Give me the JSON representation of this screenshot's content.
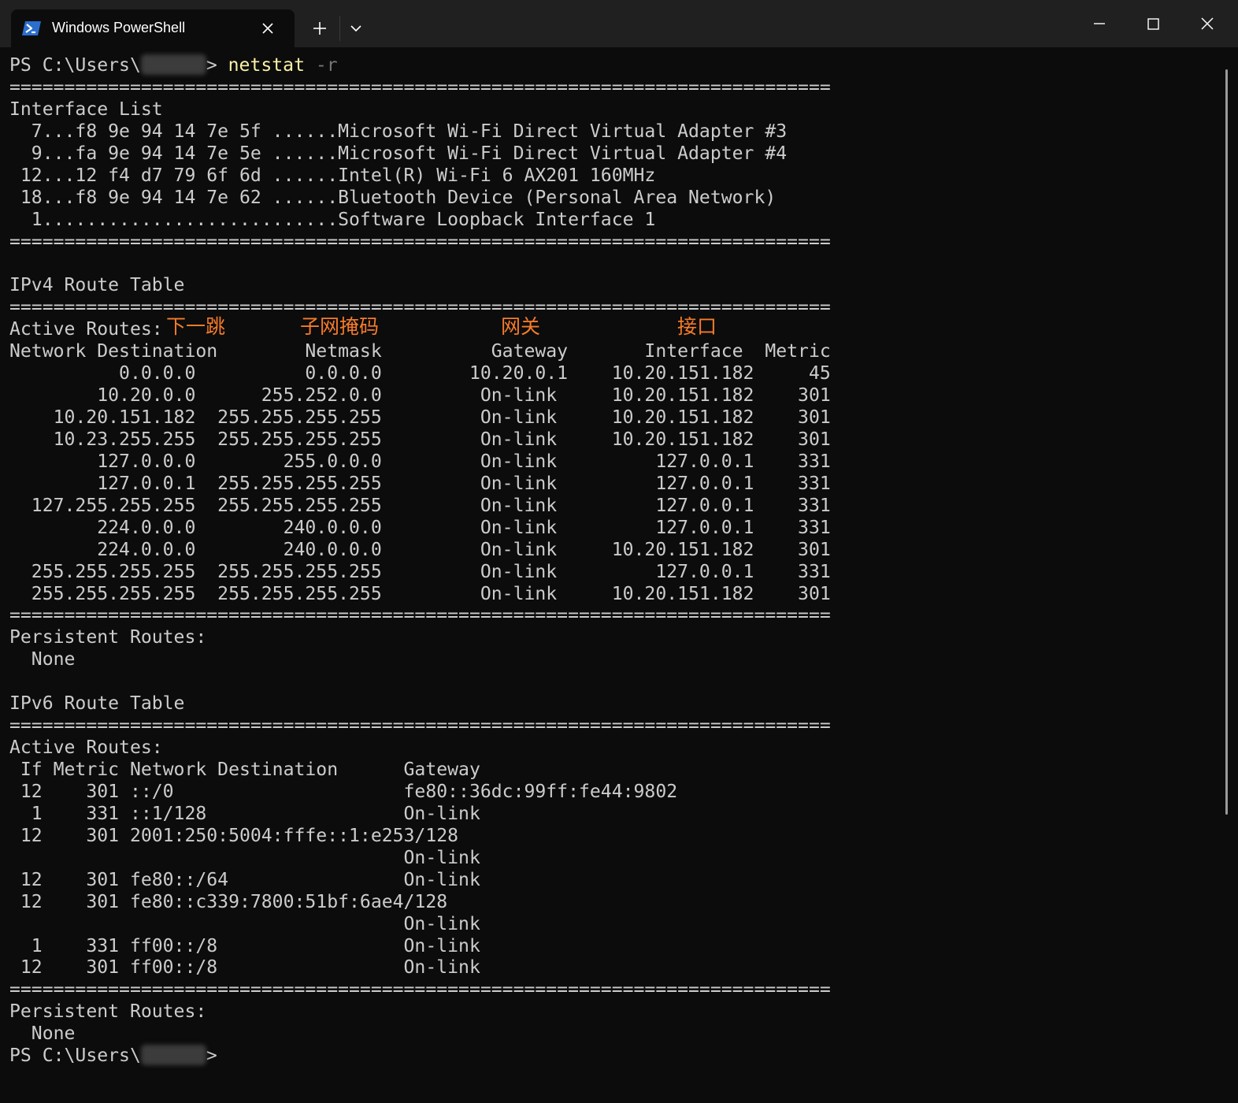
{
  "window": {
    "tab_title": "Windows PowerShell"
  },
  "terminal": {
    "prompt_prefix": "PS C:\\Users\\",
    "prompt_suffix": "> ",
    "command": "netstat",
    "command_arg": " -r",
    "final_prompt_suffix": ">",
    "lines": [
      "===========================================================================",
      "Interface List",
      "  7...f8 9e 94 14 7e 5f ......Microsoft Wi-Fi Direct Virtual Adapter #3",
      "  9...fa 9e 94 14 7e 5e ......Microsoft Wi-Fi Direct Virtual Adapter #4",
      " 12...12 f4 d7 79 6f 6d ......Intel(R) Wi-Fi 6 AX201 160MHz",
      " 18...f8 9e 94 14 7e 62 ......Bluetooth Device (Personal Area Network)",
      "  1...........................Software Loopback Interface 1",
      "===========================================================================",
      "",
      "IPv4 Route Table",
      "===========================================================================",
      "Active Routes:",
      "Network Destination        Netmask          Gateway       Interface  Metric",
      "          0.0.0.0          0.0.0.0        10.20.0.1    10.20.151.182     45",
      "        10.20.0.0      255.252.0.0         On-link     10.20.151.182    301",
      "    10.20.151.182  255.255.255.255         On-link     10.20.151.182    301",
      "    10.23.255.255  255.255.255.255         On-link     10.20.151.182    301",
      "        127.0.0.0        255.0.0.0         On-link         127.0.0.1    331",
      "        127.0.0.1  255.255.255.255         On-link         127.0.0.1    331",
      "  127.255.255.255  255.255.255.255         On-link         127.0.0.1    331",
      "        224.0.0.0        240.0.0.0         On-link         127.0.0.1    331",
      "        224.0.0.0        240.0.0.0         On-link     10.20.151.182    301",
      "  255.255.255.255  255.255.255.255         On-link         127.0.0.1    331",
      "  255.255.255.255  255.255.255.255         On-link     10.20.151.182    301",
      "===========================================================================",
      "Persistent Routes:",
      "  None",
      "",
      "IPv6 Route Table",
      "===========================================================================",
      "Active Routes:",
      " If Metric Network Destination      Gateway",
      " 12    301 ::/0                     fe80::36dc:99ff:fe44:9802",
      "  1    331 ::1/128                  On-link",
      " 12    301 2001:250:5004:fffe::1:e253/128",
      "                                    On-link",
      " 12    301 fe80::/64                On-link",
      " 12    301 fe80::c339:7800:51bf:6ae4/128",
      "                                    On-link",
      "  1    331 ff00::/8                 On-link",
      " 12    301 ff00::/8                 On-link",
      "===========================================================================",
      "Persistent Routes:",
      "  None"
    ]
  },
  "annotations": {
    "next_hop": "下一跳",
    "subnet_mask": "子网掩码",
    "gateway": "网关",
    "interface": "接口",
    "color": "#f57b2a"
  },
  "colors": {
    "background": "#0c0c0c",
    "text": "#cccccc",
    "command": "#f9f1a5",
    "flag": "#767676",
    "titlebar": "#202020"
  },
  "icons": {
    "tab": "powershell-icon",
    "tab_close": "close-icon",
    "new_tab": "plus-icon",
    "dropdown": "chevron-down-icon",
    "minimize": "minimize-icon",
    "maximize": "maximize-icon",
    "close": "close-icon"
  }
}
